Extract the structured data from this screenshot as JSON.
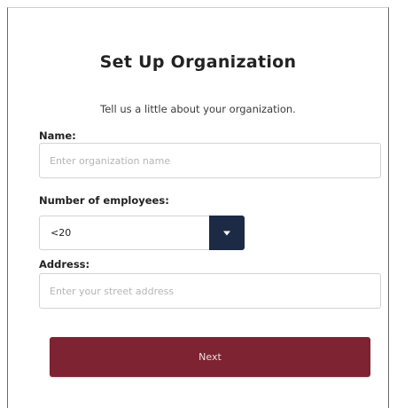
{
  "form": {
    "title": "Set Up Organization",
    "subtitle": "Tell us a little about your organization."
  },
  "fields": {
    "name": {
      "label": "Name:",
      "placeholder": "Enter organization name",
      "value": ""
    },
    "employees": {
      "label": "Number of employees:",
      "selected": "<20",
      "toggle_icon": "caret-down-icon"
    },
    "address": {
      "label": "Address:",
      "placeholder": "Enter your street address",
      "value": ""
    }
  },
  "actions": {
    "next_label": "Next"
  },
  "colors": {
    "primary_button": "#7d2331",
    "select_toggle": "#1c2a45",
    "input_border": "#d3d3d3",
    "placeholder_text": "#b5b5b5"
  }
}
